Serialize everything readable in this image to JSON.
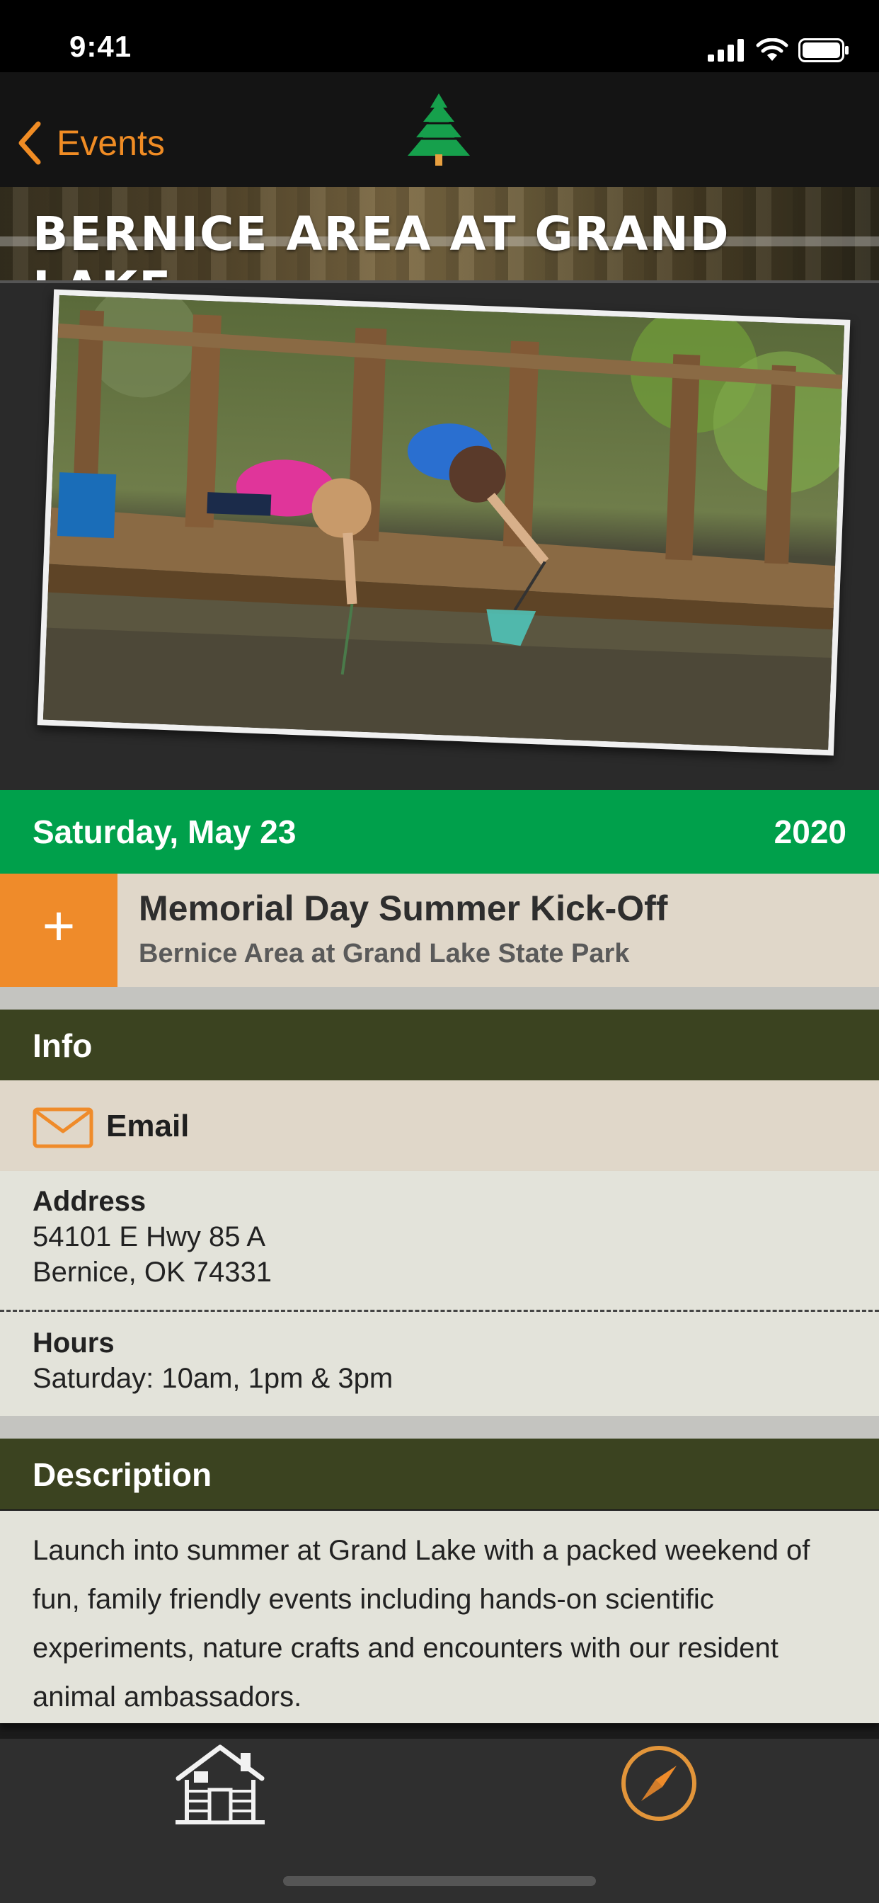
{
  "status_bar": {
    "time": "9:41"
  },
  "nav": {
    "back_label": "Events",
    "logo_icon": "pine-tree-icon"
  },
  "hero": {
    "title": "BERNICE AREA AT GRAND LAKE"
  },
  "event": {
    "date": "Saturday, May 23",
    "year": "2020",
    "add_label": "+",
    "title": "Memorial Day Summer Kick-Off",
    "location": "Bernice Area at Grand Lake State Park"
  },
  "info": {
    "header": "Info",
    "email_label": "Email",
    "address_label": "Address",
    "address_line1": "54101 E Hwy 85 A",
    "address_line2": "Bernice, OK 74331",
    "hours_label": "Hours",
    "hours_value": "Saturday: 10am, 1pm & 3pm"
  },
  "description": {
    "header": "Description",
    "text": "Launch into summer at Grand Lake with a packed weekend of fun, family friendly events including hands-on scientific experiments, nature crafts and encounters with our resident animal ambassadors."
  },
  "tab_bar": {
    "home_icon": "cabin-icon",
    "explore_icon": "compass-icon"
  },
  "colors": {
    "accent_orange": "#ef8b2a",
    "date_green": "#00a04b",
    "section_olive": "#3b4320",
    "row_tan": "#e0d7c9"
  }
}
